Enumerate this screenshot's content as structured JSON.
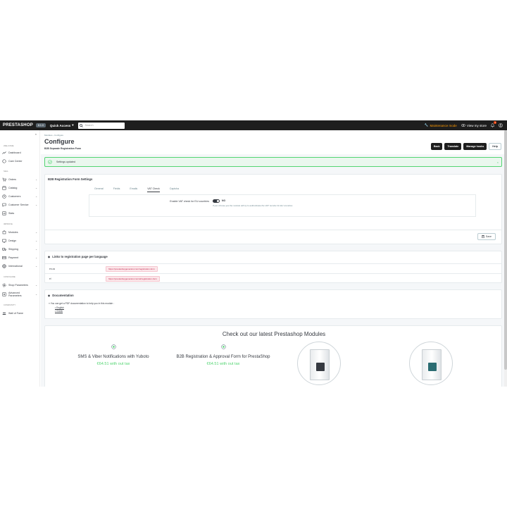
{
  "topbar": {
    "logo": "PRESTASHOP",
    "version": "8.1.0",
    "quick_access": "Quick Access",
    "search_placeholder": "Search",
    "maintenance": "Maintenance mode",
    "view_store": "View my store",
    "notifications_count": "1"
  },
  "sidebar": {
    "sections": {
      "welcome": "WELCOME",
      "sell": "SELL",
      "improve": "IMPROVE",
      "configure": "CONFIGURE",
      "community": "COMMUNITY"
    },
    "items": {
      "dashboard": "Dashboard",
      "care_center": "Care Center",
      "orders": "Orders",
      "catalog": "Catalog",
      "customers": "Customers",
      "customer_service": "Customer Service",
      "stats": "Stats",
      "modules": "Modules",
      "design": "Design",
      "shipping": "Shipping",
      "payment": "Payment",
      "international": "International",
      "shop_parameters": "Shop Parameters",
      "advanced_parameters": "Advanced Parameters",
      "wall_of_fame": "Wall of Fame"
    }
  },
  "header": {
    "breadcrumb_1": "Modules",
    "breadcrumb_sep": "›",
    "breadcrumb_2": "Configure",
    "title": "Configure",
    "subtitle": "B2B Separate Registration Form",
    "buttons": {
      "back": "Back",
      "translate": "Translate",
      "manage_hooks": "Manage hooks",
      "help": "Help"
    }
  },
  "alert": {
    "message": "Settings updated"
  },
  "settings_panel": {
    "title": "B2B Registration Form Settings",
    "tabs": [
      "General",
      "Fields",
      "Emails",
      "VAT Check",
      "Captcha"
    ],
    "active_tab": "VAT Check",
    "vat_label": "Enable VAT check for EU countries",
    "vat_value": "NO",
    "vat_help": "If you choose yes the module will try to authenticate the VAT number for EU countries",
    "save": "Save"
  },
  "links_panel": {
    "title": "Links to registration page per language",
    "rows": [
      {
        "lang": "en-us",
        "url": "https://prestashopgenerator.com/registration-form"
      },
      {
        "lang": "el",
        "url": "https://prestashopgenerator.com/el/registration-form"
      }
    ]
  },
  "doc_panel": {
    "title": "Documentation",
    "text": "» You can get a PDF documentation to help you in this module :",
    "links": [
      "English",
      "Greek"
    ]
  },
  "promo": {
    "title": "Check out our latest Prestashop Modules",
    "modules": [
      {
        "name": "SMS & Viber Notifications with Yuboto",
        "price": "€64.51 with out tax"
      },
      {
        "name": "B2B Registration & Approval Form for PrestaShop",
        "price": "€64.51 with out tax"
      }
    ]
  },
  "colors": {
    "topbar": "#1e1e1e",
    "success": "#53d572",
    "maintenance": "#ff9a00",
    "text": "#363a41"
  }
}
